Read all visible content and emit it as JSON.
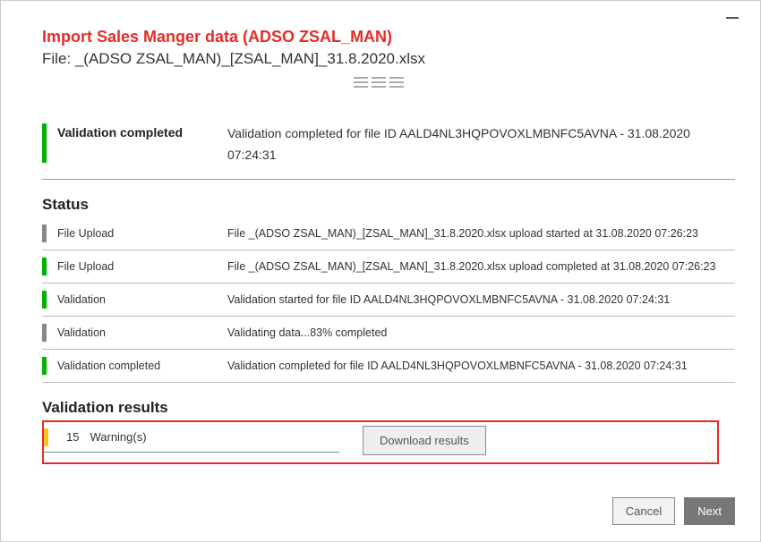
{
  "header": {
    "title": "Import  Sales Manger data (ADSO ZSAL_MAN)",
    "file_line": "File: _(ADSO ZSAL_MAN)_[ZSAL_MAN]_31.8.2020.xlsx"
  },
  "summary": {
    "bar_color": "green",
    "label": "Validation completed",
    "text": "Validation completed for file ID AALD4NL3HQPOVOXLMBNFC5AVNA - 31.08.2020 07:24:31"
  },
  "sections": {
    "status_title": "Status",
    "results_title": "Validation results"
  },
  "status_rows": [
    {
      "bar": "gray",
      "label": "File Upload",
      "desc": "File _(ADSO ZSAL_MAN)_[ZSAL_MAN]_31.8.2020.xlsx upload started at 31.08.2020 07:26:23"
    },
    {
      "bar": "green",
      "label": "File Upload",
      "desc": "File _(ADSO ZSAL_MAN)_[ZSAL_MAN]_31.8.2020.xlsx upload completed at 31.08.2020 07:26:23"
    },
    {
      "bar": "green",
      "label": "Validation",
      "desc": "Validation started for file ID AALD4NL3HQPOVOXLMBNFC5AVNA - 31.08.2020 07:24:31"
    },
    {
      "bar": "gray",
      "label": "Validation",
      "desc": "Validating data...83% completed"
    },
    {
      "bar": "green",
      "label": "Validation completed",
      "desc": "Validation completed for file ID AALD4NL3HQPOVOXLMBNFC5AVNA - 31.08.2020 07:24:31"
    }
  ],
  "results": {
    "count": "15",
    "label": "Warning(s)",
    "download_label": "Download results"
  },
  "footer": {
    "cancel": "Cancel",
    "next": "Next"
  }
}
